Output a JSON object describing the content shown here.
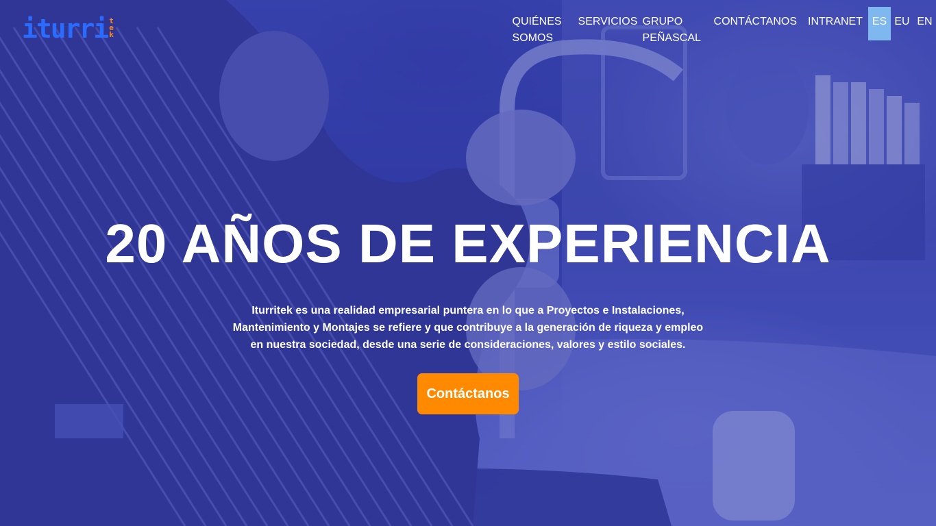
{
  "brand": {
    "logo_main": "iturri",
    "logo_suffix": [
      "t",
      "e",
      "k"
    ],
    "colors": {
      "logo_blue": "#2a6cff",
      "logo_orange": "#ff8a1a"
    }
  },
  "nav": {
    "items": [
      {
        "label": "QUIÉNES SOMOS"
      },
      {
        "label": "SERVICIOS"
      },
      {
        "label": "GRUPO PEÑASCAL"
      },
      {
        "label": "CONTÁCTANOS"
      },
      {
        "label": "INTRANET"
      }
    ],
    "languages": [
      {
        "label": "ES",
        "active": true
      },
      {
        "label": "EU",
        "active": false
      },
      {
        "label": "EN",
        "active": false
      }
    ],
    "active_language_color": "#7fb8ee"
  },
  "hero": {
    "headline": "20 AÑOS DE EXPERIENCIA",
    "description": "Iturritek es una realidad empresarial puntera en lo que a Proyectos e Instalaciones, Mantenimiento y Montajes se refiere y que contribuye a la generación de riqueza y empleo en nuestra sociedad, desde una serie de consideraciones, valores y estilo sociales.",
    "cta_label": "Contáctanos",
    "cta_color": "#ff8a00"
  }
}
